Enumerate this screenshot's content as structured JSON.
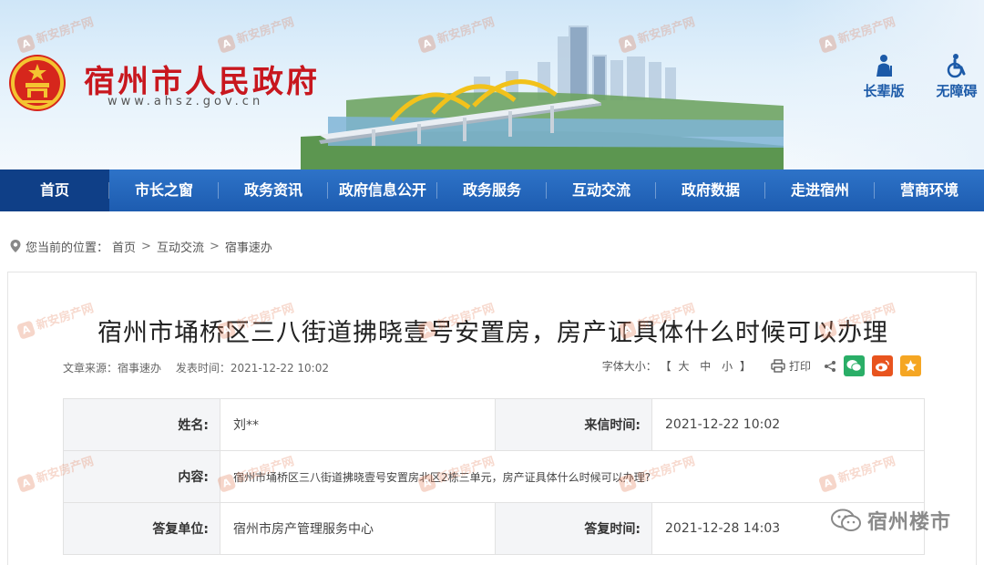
{
  "site": {
    "title": "宿州市人民政府",
    "url": "www.ahszgov.cn"
  },
  "header_tools": [
    {
      "label": "长辈版",
      "icon": "elder-mode-icon"
    },
    {
      "label": "无障碍",
      "icon": "accessibility-icon"
    }
  ],
  "nav": [
    {
      "label": "首页",
      "active": true
    },
    {
      "label": "市长之窗"
    },
    {
      "label": "政务资讯"
    },
    {
      "label": "政府信息公开"
    },
    {
      "label": "政务服务"
    },
    {
      "label": "互动交流"
    },
    {
      "label": "政府数据"
    },
    {
      "label": "走进宿州"
    },
    {
      "label": "营商环境"
    }
  ],
  "breadcrumb": {
    "prefix": "您当前的位置：",
    "items": [
      "首页",
      "互动交流",
      "宿事速办"
    ],
    "separator": ">"
  },
  "article": {
    "title": "宿州市埇桥区三八街道拂晓壹号安置房，房产证具体什么时候可以办理",
    "source_label": "文章来源：宿事速办",
    "time_label": "发表时间：2021-12-22 10:02",
    "font_size_label": "字体大小：",
    "font_size_bracket_open": "【",
    "font_sizes": [
      "大",
      "中",
      "小"
    ],
    "font_size_bracket_close": "】",
    "print_label": "打印"
  },
  "table": {
    "rows": [
      {
        "k1": "姓名:",
        "v1": "刘**",
        "k2": "来信时间:",
        "v2": "2021-12-22 10:02"
      },
      {
        "k1": "内容:",
        "v1": "宿州市埇桥区三八街道拂晓壹号安置房北区2栋三单元，房产证具体什么时候可以办理?"
      },
      {
        "k1": "答复单位:",
        "v1": "宿州市房产管理服务中心",
        "k2": "答复时间:",
        "v2": "2021-12-28 14:03"
      }
    ]
  },
  "watermark": {
    "text": "新安房产网",
    "logo": "A"
  },
  "wechat": {
    "account": "宿州楼市"
  },
  "colors": {
    "title_red": "#c8171e",
    "nav_blue": "#1d5cb0",
    "nav_active": "#0f3f87",
    "wechat_green": "#2aae67",
    "weibo_orange": "#e8541e",
    "star_orange": "#f5a623"
  }
}
